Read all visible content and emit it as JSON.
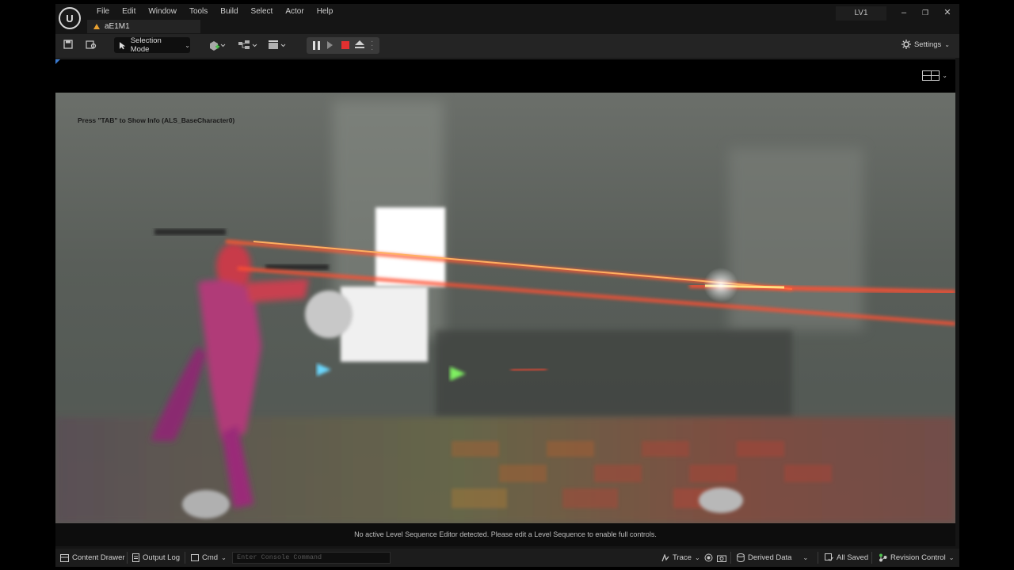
{
  "menu": [
    "File",
    "Edit",
    "Window",
    "Tools",
    "Build",
    "Select",
    "Actor",
    "Help"
  ],
  "level_tab": "aE1M1",
  "level_name": "LV1",
  "window_controls": {
    "minimize": "–",
    "restore": "❐",
    "close": "✕"
  },
  "toolbar": {
    "selection_mode": "Selection Mode",
    "settings": "Settings"
  },
  "viewport": {
    "hint": "Press \"TAB\" to Show Info (ALS_BaseCharacter0)",
    "sequence_message": "No active Level Sequence Editor detected. Please edit a Level Sequence to enable full controls."
  },
  "bottombar": {
    "content_drawer": "Content Drawer",
    "output_log": "Output Log",
    "cmd": "Cmd",
    "console_placeholder": "Enter Console Command",
    "trace": "Trace",
    "derived_data": "Derived Data",
    "all_saved": "All Saved",
    "revision_control": "Revision Control"
  },
  "colors": {
    "accent_blue": "#3a7ad0",
    "stop_red": "#e03030",
    "warning": "#e8a030"
  }
}
